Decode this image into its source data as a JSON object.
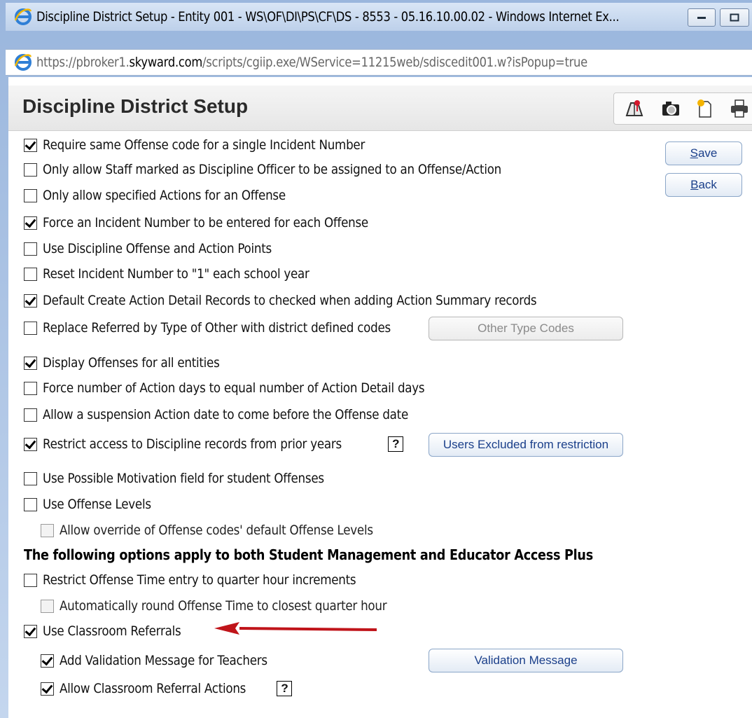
{
  "window": {
    "title": "Discipline District Setup - Entity 001 - WS\\OF\\DI\\PS\\CF\\DS - 8553 - 05.16.10.00.02 - Windows Internet Ex...",
    "url_prefix": "https://pbroker1.",
    "url_domain": "skyward.com",
    "url_path": "/scripts/cgiip.exe/WService=11215web/sdiscedit001.w?isPopup=true"
  },
  "page": {
    "title": "Discipline District Setup",
    "toolbar_icons": [
      "help-map-icon",
      "camera-icon",
      "document-icon",
      "print-icon"
    ]
  },
  "buttons": {
    "save": {
      "underline": "S",
      "rest": "ave"
    },
    "back": {
      "underline": "B",
      "rest": "ack"
    },
    "other_type_codes": "Other Type Codes",
    "users_excluded": "Users Excluded from restriction",
    "validation_message": "Validation Message"
  },
  "options": [
    {
      "label": "Require same Offense code for a single Incident Number",
      "checked": true
    },
    {
      "label": "Only allow Staff marked as Discipline Officer to be assigned to an Offense/Action",
      "checked": false
    },
    {
      "label": "Only allow specified Actions for an Offense",
      "checked": false
    },
    {
      "label": "Force an Incident Number to be entered for each Offense",
      "checked": true
    },
    {
      "label": "Use Discipline Offense and Action Points",
      "checked": false
    },
    {
      "label": "Reset Incident Number to \"1\" each school year",
      "checked": false
    },
    {
      "label": "Default Create Action Detail Records to checked when adding Action Summary records",
      "checked": true
    },
    {
      "label": "Replace Referred by Type of Other with district defined codes",
      "checked": false
    },
    {
      "label": "Display Offenses for all entities",
      "checked": true
    },
    {
      "label": "Force number of Action days to equal number of Action Detail days",
      "checked": false
    },
    {
      "label": "Allow a suspension Action date to come before the Offense date",
      "checked": false
    },
    {
      "label": "Restrict access to Discipline records from prior years",
      "checked": true
    },
    {
      "label": "Use Possible Motivation field for student Offenses",
      "checked": false
    },
    {
      "label": "Use Offense Levels",
      "checked": false
    },
    {
      "label": "Allow override of Offense codes' default Offense Levels",
      "checked": false,
      "disabled": true
    }
  ],
  "section_heading": "The following options apply to both Student Management and Educator Access Plus",
  "options2": [
    {
      "label": "Restrict Offense Time entry to quarter hour increments",
      "checked": false
    },
    {
      "label": "Automatically round Offense Time to closest quarter hour",
      "checked": false,
      "disabled": true
    },
    {
      "label": "Use Classroom Referrals",
      "checked": true
    },
    {
      "label": "Add Validation Message for Teachers",
      "checked": true
    },
    {
      "label": "Allow Classroom Referral Actions",
      "checked": true
    }
  ],
  "help_glyph": "?",
  "colors": {
    "accent_link": "#1a3f8a",
    "arrow": "#c0141a"
  }
}
